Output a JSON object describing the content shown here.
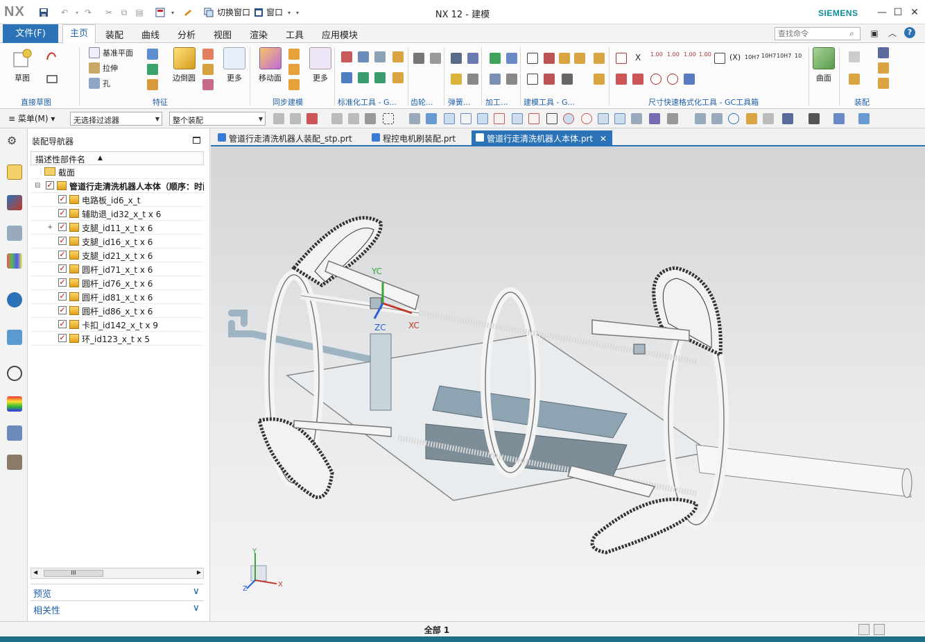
{
  "window": {
    "app_logo": "NX",
    "title": "NX 12 - 建模",
    "brand": "SIEMENS",
    "switch_window": "切换窗口",
    "window_menu": "窗口"
  },
  "ribbon": {
    "file_tab": "文件(F)",
    "tabs": [
      "主页",
      "装配",
      "曲线",
      "分析",
      "视图",
      "渲染",
      "工具",
      "应用模块"
    ],
    "active_tab": "主页",
    "search_placeholder": "查找命令",
    "buttons": {
      "sketch": "草图",
      "datum_plane": "基准平面",
      "extrude": "拉伸",
      "hole": "孔",
      "edge_blend": "边倒圆",
      "more1": "更多",
      "move_face": "移动面",
      "more2": "更多",
      "surface": "曲面"
    },
    "groups": [
      "直接草图",
      "特征",
      "同步建模",
      "标准化工具 - G...",
      "齿轮...",
      "弹簧...",
      "加工...",
      "建模工具 - G...",
      "尺寸快速格式化工具 - GC工具箱",
      "装配"
    ],
    "tolerance_labels": [
      "1.00",
      "1.00",
      "1.00",
      "1.00"
    ],
    "fit_labels": [
      "10H7",
      "10H7",
      "10H7",
      "10"
    ]
  },
  "toolbar2": {
    "menu": "菜单(M)",
    "filter": "无选择过滤器",
    "scope": "整个装配"
  },
  "navigator": {
    "title": "装配导航器",
    "column_header": "描述性部件名",
    "sections_label": "截面",
    "root": "管道行走清洗机器人本体（顺序：时间",
    "items": [
      "电路板_id6_x_t",
      "辅助退_id32_x_t x 6",
      "支腿_id11_x_t x 6",
      "支腿_id16_x_t x 6",
      "支腿_id21_x_t x 6",
      "圆杆_id71_x_t x 6",
      "圆杆_id76_x_t x 6",
      "圆杆_id81_x_t x 6",
      "圆杆_id86_x_t x 6",
      "卡扣_id142_x_t x 9",
      "环_id123_x_t x 5"
    ],
    "preview": "预览",
    "dependencies": "相关性"
  },
  "doc_tabs": [
    "管道行走清洗机器人装配_stp.prt",
    "程控电机刷装配.prt",
    "管道行走清洗机器人本体.prt"
  ],
  "graphics": {
    "wcs": {
      "x": "XC",
      "y": "YC",
      "z": "ZC"
    },
    "triad": {
      "x": "X",
      "y": "Y",
      "z": "Z"
    }
  },
  "status": {
    "text": "全部 1"
  },
  "colors": {
    "accent": "#2b73b6",
    "brand": "#0a8c9b",
    "check": "#cc0000",
    "bottom_band": "#1f6e88"
  }
}
